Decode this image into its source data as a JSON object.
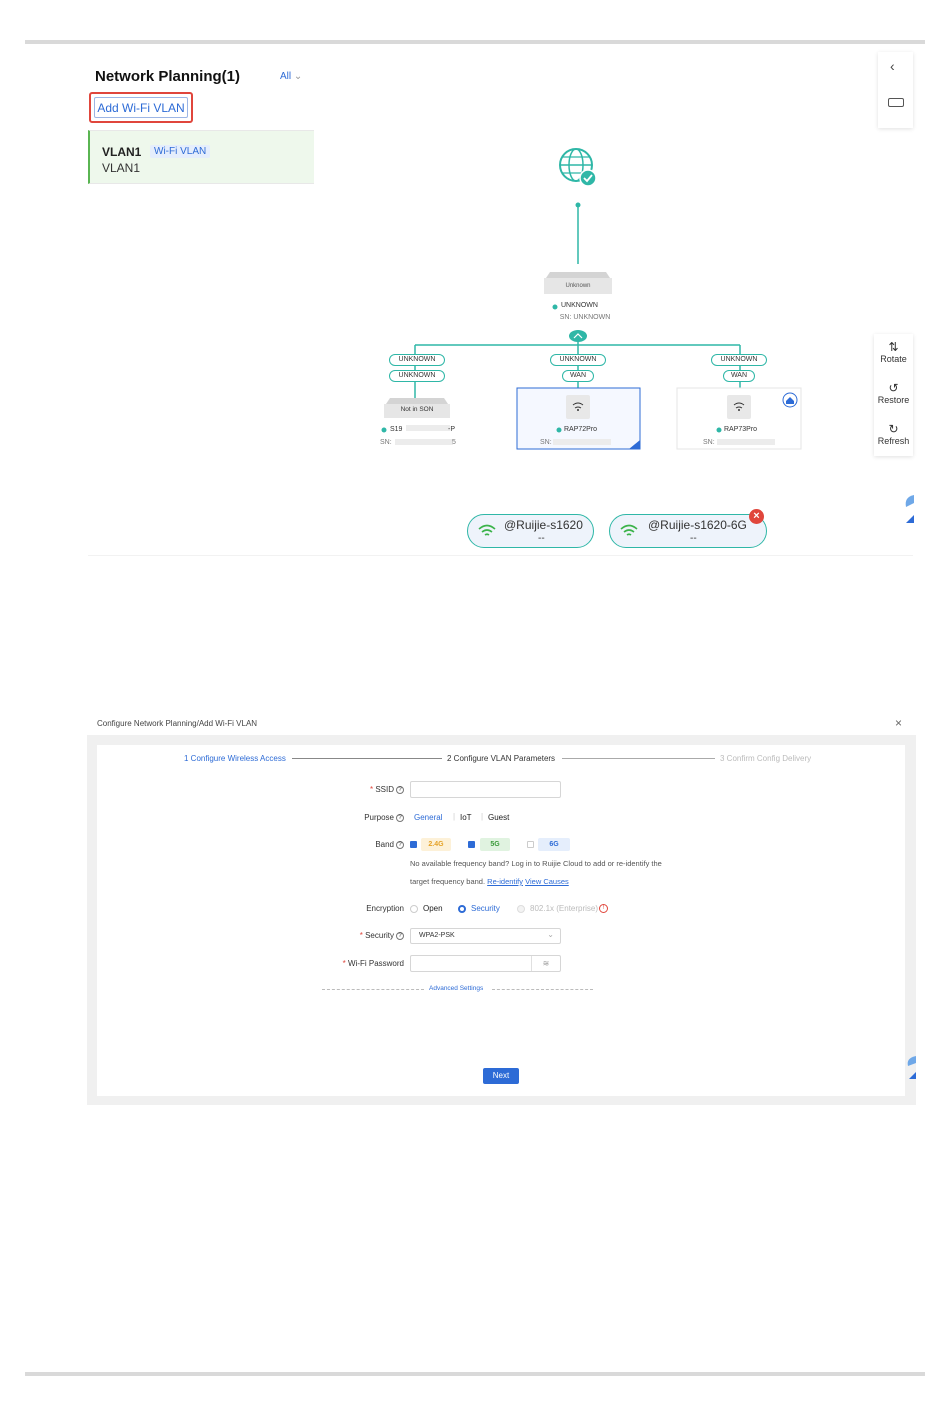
{
  "planning": {
    "title": "Network Planning(1)",
    "filter_label": "All",
    "add_button": "Add Wi-Fi VLAN",
    "vlans": [
      {
        "name": "VLAN1",
        "tag": "Wi-Fi VLAN",
        "sub": "VLAN1"
      }
    ]
  },
  "topology": {
    "root_device": {
      "label": "Unknown",
      "status": "UNKNOWN",
      "sn": "SN: UNKNOWN"
    },
    "branches": [
      {
        "port_top": "UNKNOWN",
        "port_bottom": "UNKNOWN",
        "device_label": "Not in SON",
        "name": "S19",
        "name_suffix": "-P",
        "sn": "SN:",
        "sn_suffix": "5"
      },
      {
        "port_top": "UNKNOWN",
        "port_bottom": "WAN",
        "name": "RAP72Pro",
        "sn": "SN:"
      },
      {
        "port_top": "UNKNOWN",
        "port_bottom": "WAN",
        "name": "RAP73Pro",
        "sn": "SN:"
      }
    ],
    "ssids": [
      {
        "name": "@Ruijie-s1620",
        "value": "--"
      },
      {
        "name": "@Ruijie-s1620-6G",
        "value": "--"
      }
    ],
    "tools": {
      "rotate": "Rotate",
      "restore": "Restore",
      "refresh": "Refresh"
    }
  },
  "dialog": {
    "title": "Configure Network Planning/Add Wi-Fi VLAN",
    "steps": [
      "1 Configure Wireless Access",
      "2 Configure VLAN Parameters",
      "3 Confirm Config Delivery"
    ],
    "ssid_label": "SSID",
    "ssid_value": "",
    "purpose_label": "Purpose",
    "purpose_options": [
      "General",
      "IoT",
      "Guest"
    ],
    "band_label": "Band",
    "bands": [
      "2.4G",
      "5G",
      "6G"
    ],
    "band_note_1": "No available frequency band? Log in to Ruijie Cloud to add or re-identify the",
    "band_note_2": "target frequency band.",
    "reidentify_link": "Re-identify",
    "view_causes_link": "View Causes",
    "encryption_label": "Encryption",
    "encryption_options": [
      "Open",
      "Security",
      "802.1x (Enterprise)"
    ],
    "security_label": "Security",
    "security_value": "WPA2-PSK",
    "password_label": "Wi-Fi Password",
    "password_value": "",
    "advanced_label": "Advanced Settings",
    "next_label": "Next"
  },
  "colors": {
    "accent": "#2d6bd6",
    "teal": "#2fb7a7",
    "danger": "#e0463c"
  }
}
